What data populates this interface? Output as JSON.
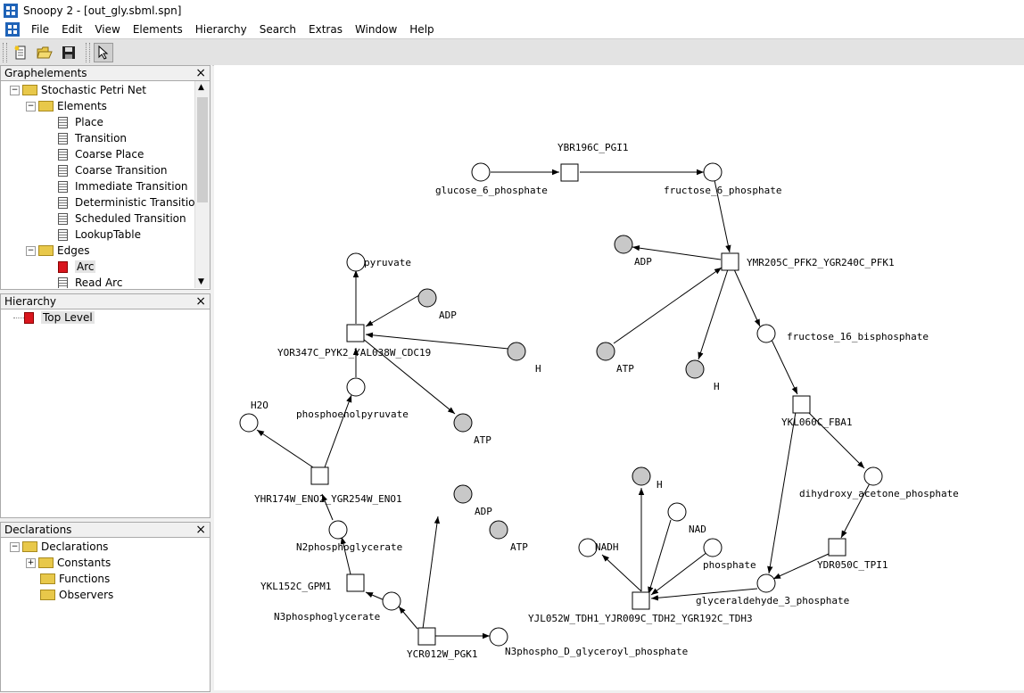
{
  "window": {
    "title": "Snoopy 2 - [out_gly.sbml.spn]"
  },
  "menubar": {
    "items": [
      "File",
      "Edit",
      "View",
      "Elements",
      "Hierarchy",
      "Search",
      "Extras",
      "Window",
      "Help"
    ]
  },
  "toolbar": {
    "buttons": [
      "new-file-icon",
      "open-folder-icon",
      "save-icon",
      "pointer-icon"
    ]
  },
  "graphelements": {
    "title": "Graphelements",
    "close": "×",
    "tree": {
      "root": "Stochastic Petri Net",
      "elements_label": "Elements",
      "elements": [
        "Place",
        "Transition",
        "Coarse Place",
        "Coarse Transition",
        "Immediate Transition",
        "Deterministic Transition",
        "Scheduled Transition",
        "LookupTable"
      ],
      "edges_label": "Edges",
      "edges": [
        "Arc",
        "Read Arc"
      ]
    }
  },
  "hierarchy": {
    "title": "Hierarchy",
    "close": "×",
    "items": [
      "Top Level"
    ]
  },
  "declarations": {
    "title": "Declarations",
    "close": "×",
    "root": "Declarations",
    "items": [
      "Constants",
      "Functions",
      "Observers"
    ]
  },
  "net": {
    "colors": {
      "place_fill": "#ffffff",
      "shared_place_fill": "#c8c8c8",
      "stroke": "#000000"
    },
    "labels": {
      "pgi": "YBR196C_PGI1",
      "g6p": "glucose_6_phosphate",
      "f6p": "fructose_6_phosphate",
      "adp_pfk": "ADP",
      "pfk": "YMR205C_PFK2_YGR240C_PFK1",
      "atp_pfk": "ATP",
      "h_pfk": "H",
      "f16bp": "fructose_16_bisphosphate",
      "fba": "YKL060C_FBA1",
      "dhap": "dihydroxy_acetone_phosphate",
      "tpi": "YDR050C_TPI1",
      "g3p": "glyceraldehyde_3_phosphate",
      "h_tdh": "H",
      "nad": "NAD",
      "nadh": "NADH",
      "phosphate": "phosphate",
      "tdh": "YJL052W_TDH1_YJR009C_TDH2_YGR192C_TDH3",
      "bpg": "N3phospho_D_glyceroyl_phosphate",
      "pgk": "YCR012W_PGK1",
      "adp_pgk": "ADP",
      "atp_pgk": "ATP",
      "pg3": "N3phosphoglycerate",
      "gpm": "YKL152C_GPM1",
      "pg2": "N2phosphoglycerate",
      "eno": "YHR174W_ENO2_YGR254W_ENO1",
      "h2o": "H2O",
      "pep": "phosphoenolpyruvate",
      "atp_pyk": "ATP",
      "pyk": "YOR347C_PYK2_YAL038W_CDC19",
      "h_pyk": "H",
      "adp_pyk": "ADP",
      "pyruvate": "pyruvate"
    }
  }
}
